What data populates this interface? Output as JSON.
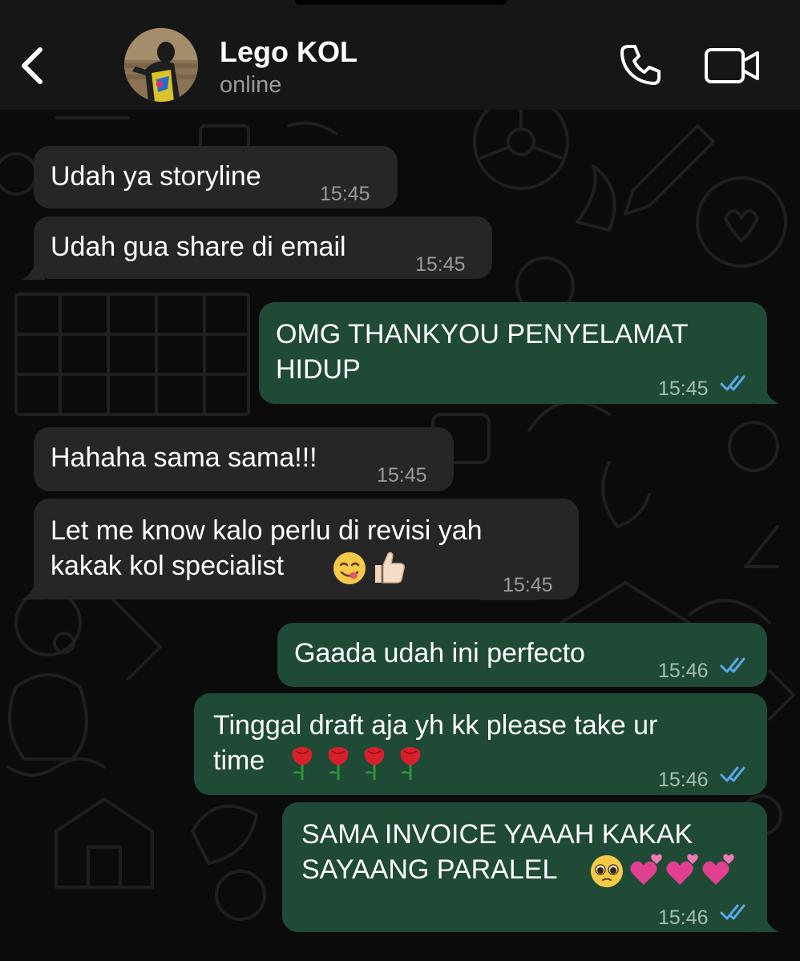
{
  "header": {
    "contact_name": "Lego KOL",
    "contact_status": "online",
    "icons": {
      "back": "chevron-left-icon",
      "call": "phone-icon",
      "video": "video-camera-icon"
    }
  },
  "colors": {
    "header_bg": "#161616",
    "chat_bg": "#0b0b0b",
    "incoming_bubble": "#262626",
    "outgoing_bubble": "#1f4a36",
    "read_ticks": "#5aa8e8",
    "timestamp": "#9a9a9a"
  },
  "messages": [
    {
      "direction": "in",
      "text": "Udah ya storyline",
      "time": "15:45"
    },
    {
      "direction": "in",
      "text": "Udah gua share di email",
      "time": "15:45"
    },
    {
      "direction": "out",
      "text_line1": "OMG THANKYOU PENYELAMAT",
      "text_line2": "HIDUP",
      "time": "15:45",
      "status": "read"
    },
    {
      "direction": "in",
      "text": "Hahaha sama sama!!!",
      "time": "15:45"
    },
    {
      "direction": "in",
      "text_line1": "Let me know kalo perlu di revisi yah",
      "text_line2": "kakak kol specialist",
      "emojis": [
        "yum-face-emoji",
        "thumbs-up-emoji"
      ],
      "time": "15:45"
    },
    {
      "direction": "out",
      "text": "Gaada udah ini perfecto",
      "time": "15:46",
      "status": "read"
    },
    {
      "direction": "out",
      "text_line1": "Tinggal draft aja yh kk please take ur",
      "text_line2": "time",
      "emojis": [
        "rose-emoji",
        "rose-emoji",
        "rose-emoji",
        "rose-emoji"
      ],
      "time": "15:46",
      "status": "read"
    },
    {
      "direction": "out",
      "text_line1": "SAMA INVOICE YAAAH KAKAK",
      "text_line2": "SAYAANG PARALEL",
      "emojis": [
        "pleading-face-emoji",
        "two-hearts-emoji",
        "two-hearts-emoji",
        "two-hearts-emoji"
      ],
      "time": "15:46",
      "status": "read"
    }
  ]
}
